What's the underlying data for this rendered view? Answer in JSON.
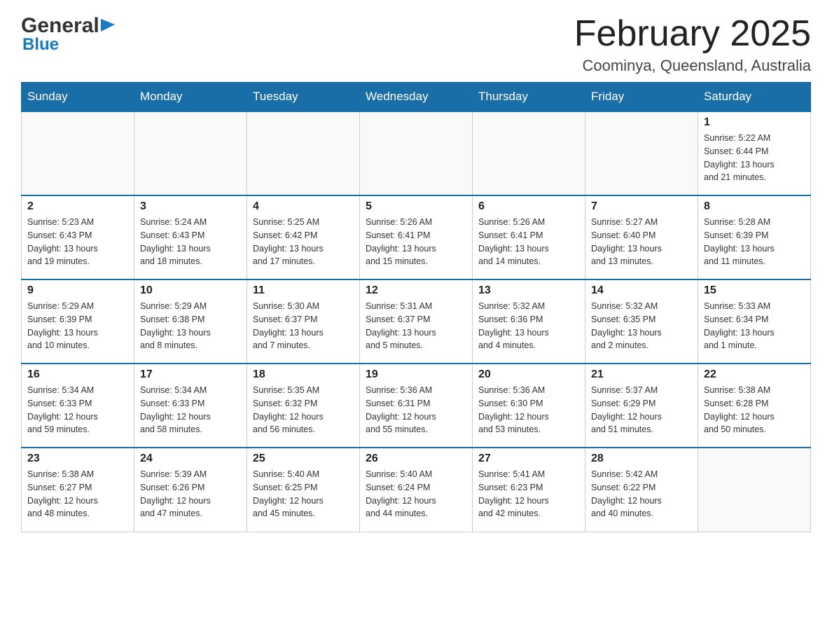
{
  "header": {
    "logo_general": "General",
    "logo_blue": "Blue",
    "month_title": "February 2025",
    "location": "Coominya, Queensland, Australia"
  },
  "weekdays": [
    "Sunday",
    "Monday",
    "Tuesday",
    "Wednesday",
    "Thursday",
    "Friday",
    "Saturday"
  ],
  "weeks": [
    {
      "days": [
        {
          "num": "",
          "info": ""
        },
        {
          "num": "",
          "info": ""
        },
        {
          "num": "",
          "info": ""
        },
        {
          "num": "",
          "info": ""
        },
        {
          "num": "",
          "info": ""
        },
        {
          "num": "",
          "info": ""
        },
        {
          "num": "1",
          "info": "Sunrise: 5:22 AM\nSunset: 6:44 PM\nDaylight: 13 hours\nand 21 minutes."
        }
      ]
    },
    {
      "days": [
        {
          "num": "2",
          "info": "Sunrise: 5:23 AM\nSunset: 6:43 PM\nDaylight: 13 hours\nand 19 minutes."
        },
        {
          "num": "3",
          "info": "Sunrise: 5:24 AM\nSunset: 6:43 PM\nDaylight: 13 hours\nand 18 minutes."
        },
        {
          "num": "4",
          "info": "Sunrise: 5:25 AM\nSunset: 6:42 PM\nDaylight: 13 hours\nand 17 minutes."
        },
        {
          "num": "5",
          "info": "Sunrise: 5:26 AM\nSunset: 6:41 PM\nDaylight: 13 hours\nand 15 minutes."
        },
        {
          "num": "6",
          "info": "Sunrise: 5:26 AM\nSunset: 6:41 PM\nDaylight: 13 hours\nand 14 minutes."
        },
        {
          "num": "7",
          "info": "Sunrise: 5:27 AM\nSunset: 6:40 PM\nDaylight: 13 hours\nand 13 minutes."
        },
        {
          "num": "8",
          "info": "Sunrise: 5:28 AM\nSunset: 6:39 PM\nDaylight: 13 hours\nand 11 minutes."
        }
      ]
    },
    {
      "days": [
        {
          "num": "9",
          "info": "Sunrise: 5:29 AM\nSunset: 6:39 PM\nDaylight: 13 hours\nand 10 minutes."
        },
        {
          "num": "10",
          "info": "Sunrise: 5:29 AM\nSunset: 6:38 PM\nDaylight: 13 hours\nand 8 minutes."
        },
        {
          "num": "11",
          "info": "Sunrise: 5:30 AM\nSunset: 6:37 PM\nDaylight: 13 hours\nand 7 minutes."
        },
        {
          "num": "12",
          "info": "Sunrise: 5:31 AM\nSunset: 6:37 PM\nDaylight: 13 hours\nand 5 minutes."
        },
        {
          "num": "13",
          "info": "Sunrise: 5:32 AM\nSunset: 6:36 PM\nDaylight: 13 hours\nand 4 minutes."
        },
        {
          "num": "14",
          "info": "Sunrise: 5:32 AM\nSunset: 6:35 PM\nDaylight: 13 hours\nand 2 minutes."
        },
        {
          "num": "15",
          "info": "Sunrise: 5:33 AM\nSunset: 6:34 PM\nDaylight: 13 hours\nand 1 minute."
        }
      ]
    },
    {
      "days": [
        {
          "num": "16",
          "info": "Sunrise: 5:34 AM\nSunset: 6:33 PM\nDaylight: 12 hours\nand 59 minutes."
        },
        {
          "num": "17",
          "info": "Sunrise: 5:34 AM\nSunset: 6:33 PM\nDaylight: 12 hours\nand 58 minutes."
        },
        {
          "num": "18",
          "info": "Sunrise: 5:35 AM\nSunset: 6:32 PM\nDaylight: 12 hours\nand 56 minutes."
        },
        {
          "num": "19",
          "info": "Sunrise: 5:36 AM\nSunset: 6:31 PM\nDaylight: 12 hours\nand 55 minutes."
        },
        {
          "num": "20",
          "info": "Sunrise: 5:36 AM\nSunset: 6:30 PM\nDaylight: 12 hours\nand 53 minutes."
        },
        {
          "num": "21",
          "info": "Sunrise: 5:37 AM\nSunset: 6:29 PM\nDaylight: 12 hours\nand 51 minutes."
        },
        {
          "num": "22",
          "info": "Sunrise: 5:38 AM\nSunset: 6:28 PM\nDaylight: 12 hours\nand 50 minutes."
        }
      ]
    },
    {
      "days": [
        {
          "num": "23",
          "info": "Sunrise: 5:38 AM\nSunset: 6:27 PM\nDaylight: 12 hours\nand 48 minutes."
        },
        {
          "num": "24",
          "info": "Sunrise: 5:39 AM\nSunset: 6:26 PM\nDaylight: 12 hours\nand 47 minutes."
        },
        {
          "num": "25",
          "info": "Sunrise: 5:40 AM\nSunset: 6:25 PM\nDaylight: 12 hours\nand 45 minutes."
        },
        {
          "num": "26",
          "info": "Sunrise: 5:40 AM\nSunset: 6:24 PM\nDaylight: 12 hours\nand 44 minutes."
        },
        {
          "num": "27",
          "info": "Sunrise: 5:41 AM\nSunset: 6:23 PM\nDaylight: 12 hours\nand 42 minutes."
        },
        {
          "num": "28",
          "info": "Sunrise: 5:42 AM\nSunset: 6:22 PM\nDaylight: 12 hours\nand 40 minutes."
        },
        {
          "num": "",
          "info": ""
        }
      ]
    }
  ]
}
